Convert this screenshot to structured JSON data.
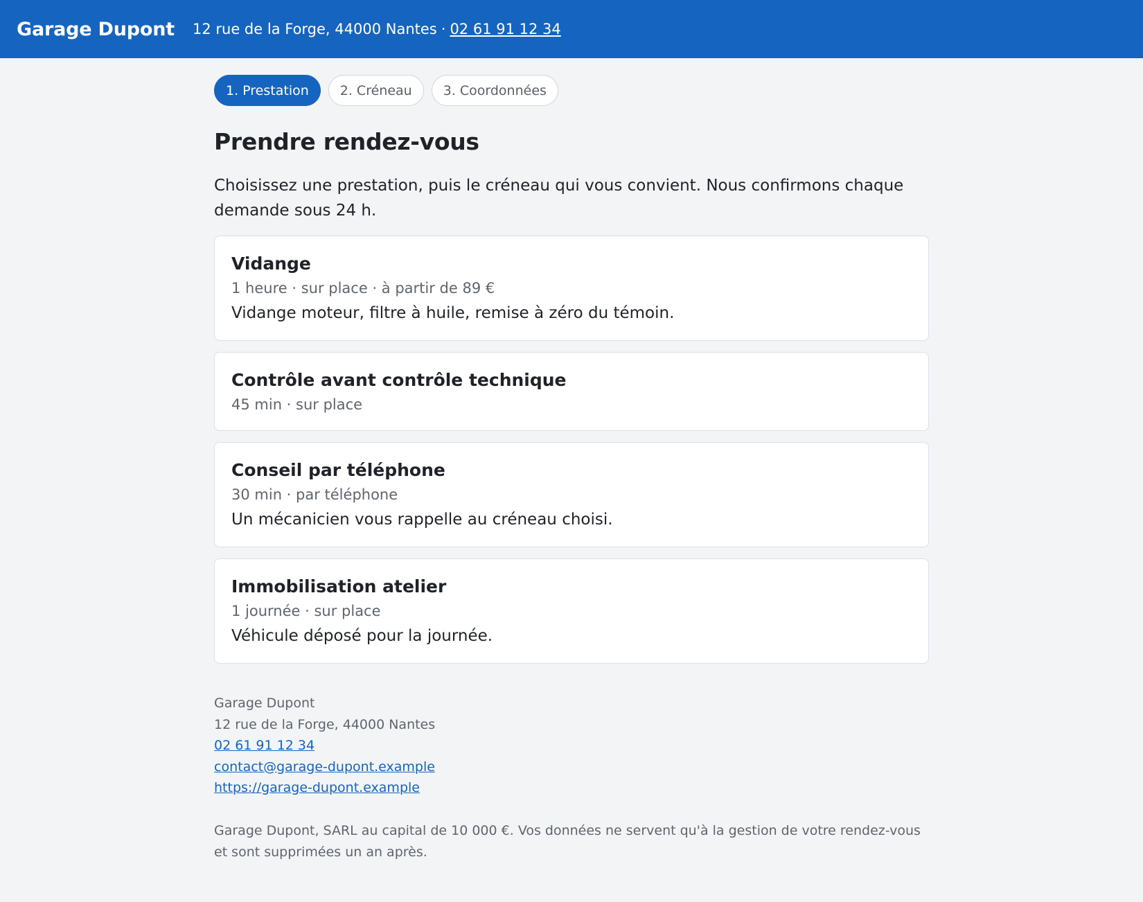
{
  "header": {
    "brand": "Garage Dupont",
    "address": "12 rue de la Forge, 44000 Nantes",
    "separator": "·",
    "phone": "02 61 91 12 34"
  },
  "steps": [
    {
      "label": "1. Prestation",
      "active": true
    },
    {
      "label": "2. Créneau",
      "active": false
    },
    {
      "label": "3. Coordonnées",
      "active": false
    }
  ],
  "page": {
    "title": "Prendre rendez-vous",
    "intro": "Choisissez une prestation, puis le créneau qui vous convient. Nous confirmons chaque demande sous 24 h."
  },
  "services": [
    {
      "title": "Vidange",
      "meta": "1 heure · sur place · à partir de 89 €",
      "description": "Vidange moteur, filtre à huile, remise à zéro du témoin."
    },
    {
      "title": "Contrôle avant contrôle technique",
      "meta": "45 min · sur place",
      "description": ""
    },
    {
      "title": "Conseil par téléphone",
      "meta": "30 min · par téléphone",
      "description": "Un mécanicien vous rappelle au créneau choisi."
    },
    {
      "title": "Immobilisation atelier",
      "meta": "1 journée · sur place",
      "description": "Véhicule déposé pour la journée."
    }
  ],
  "footer": {
    "name": "Garage Dupont",
    "address": "12 rue de la Forge, 44000 Nantes",
    "phone": "02 61 91 12 34",
    "email": "contact@garage-dupont.example",
    "website": "https://garage-dupont.example",
    "legal": "Garage Dupont, SARL au capital de 10 000 €. Vos données ne servent qu'à la gestion de votre rendez-vous et sont supprimées un an après."
  },
  "colors": {
    "accent": "#1565c0",
    "background": "#f3f4f6",
    "card": "#ffffff",
    "muted_text": "#5f656d"
  }
}
